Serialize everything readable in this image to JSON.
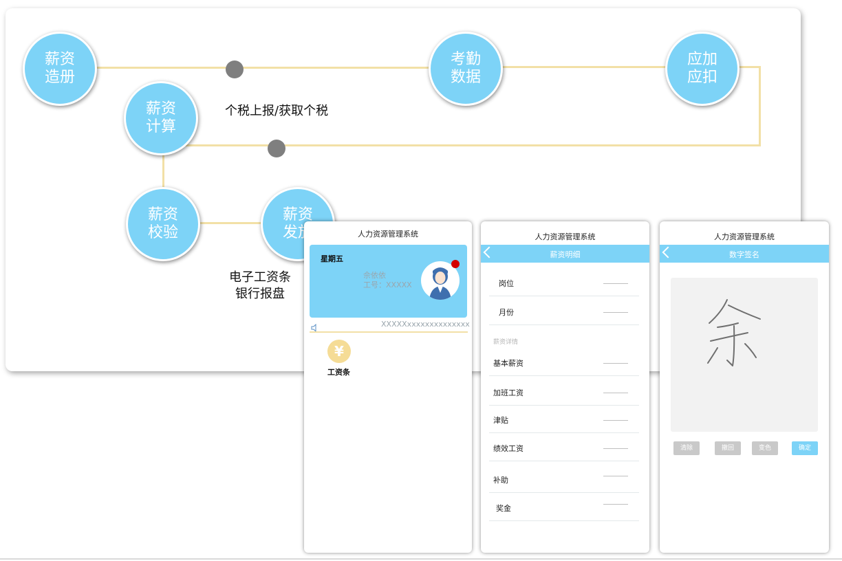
{
  "flow": {
    "nodes": {
      "roster": "薪资\n造册",
      "attendance": "考勤\n数据",
      "adjust": "应加\n应扣",
      "calc": "薪资\n计算",
      "verify": "薪资\n校验",
      "pay": "薪资\n发放"
    },
    "notes": {
      "tax": "个税上报/获取个税",
      "payout": "电子工资条\n银行报盘"
    }
  },
  "phone_home": {
    "title": "人力资源管理系统",
    "weekday": "星期五",
    "user_name": "佘依依",
    "user_id": "工号：XXXXX",
    "ticker": "XXXXXxxxxxxxxxxxxxx",
    "payslip_icon": "¥",
    "payslip_label": "工资条",
    "icons": [
      "yen-icon",
      "avatar-icon",
      "speaker-icon"
    ]
  },
  "phone_detail": {
    "title": "人力资源管理系统",
    "nav_title": "薪资明细",
    "section_label": "薪资详情",
    "rows": [
      {
        "label": "岗位"
      },
      {
        "label": "月份"
      },
      {
        "label": "基本薪资"
      },
      {
        "label": "加班工资"
      },
      {
        "label": "津贴"
      },
      {
        "label": "绩效工资"
      },
      {
        "label": "补助"
      },
      {
        "label": "奖金"
      }
    ]
  },
  "phone_sign": {
    "title": "人力资源管理系统",
    "nav_title": "数字签名",
    "buttons": {
      "clear": "清除",
      "undo": "撤回",
      "color": "变色",
      "confirm": "确定"
    }
  },
  "colors": {
    "accent": "#7dd3f7",
    "connector": "#f2e0a6",
    "dot": "#7f7f7f",
    "badge": "#d40000"
  }
}
